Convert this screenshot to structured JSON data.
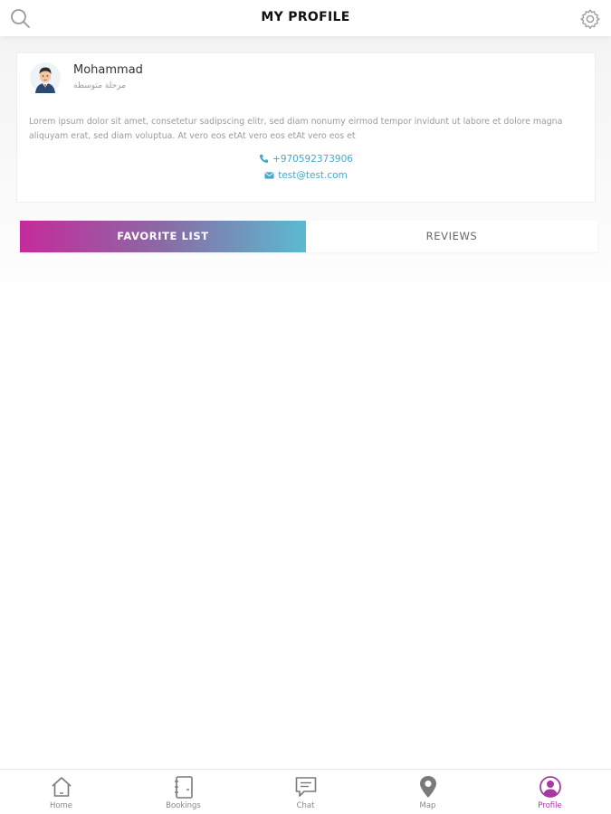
{
  "header": {
    "title": "MY PROFILE",
    "left_icon": "search-icon",
    "right_icon": "gear-icon"
  },
  "profile": {
    "name": "Mohammad",
    "subtitle": "مرحلة متوسطة",
    "bio": "Lorem ipsum dolor sit amet, consetetur sadipscing elitr, sed diam nonumy eirmod tempor invidunt ut labore et dolore magna aliquyam erat, sed diam voluptua. At vero eos etAt vero eos etAt vero eos et",
    "phone": "+970592373906",
    "email": "test@test.com"
  },
  "tabs": [
    {
      "label": "FAVORITE LIST",
      "active": true
    },
    {
      "label": "REVIEWS",
      "active": false
    }
  ],
  "bottom_nav": [
    {
      "label": "Home",
      "icon": "home-icon",
      "active": false
    },
    {
      "label": "Bookings",
      "icon": "notebook-icon",
      "active": false
    },
    {
      "label": "Chat",
      "icon": "chat-icon",
      "active": false
    },
    {
      "label": "Map",
      "icon": "map-pin-icon",
      "active": false
    },
    {
      "label": "Profile",
      "icon": "user-circle-icon",
      "active": true
    }
  ],
  "colors": {
    "accent_purple": "#a53aa3",
    "accent_blue": "#47a9c9",
    "gradient_start": "#c52b9b",
    "gradient_end": "#5bbad1"
  }
}
